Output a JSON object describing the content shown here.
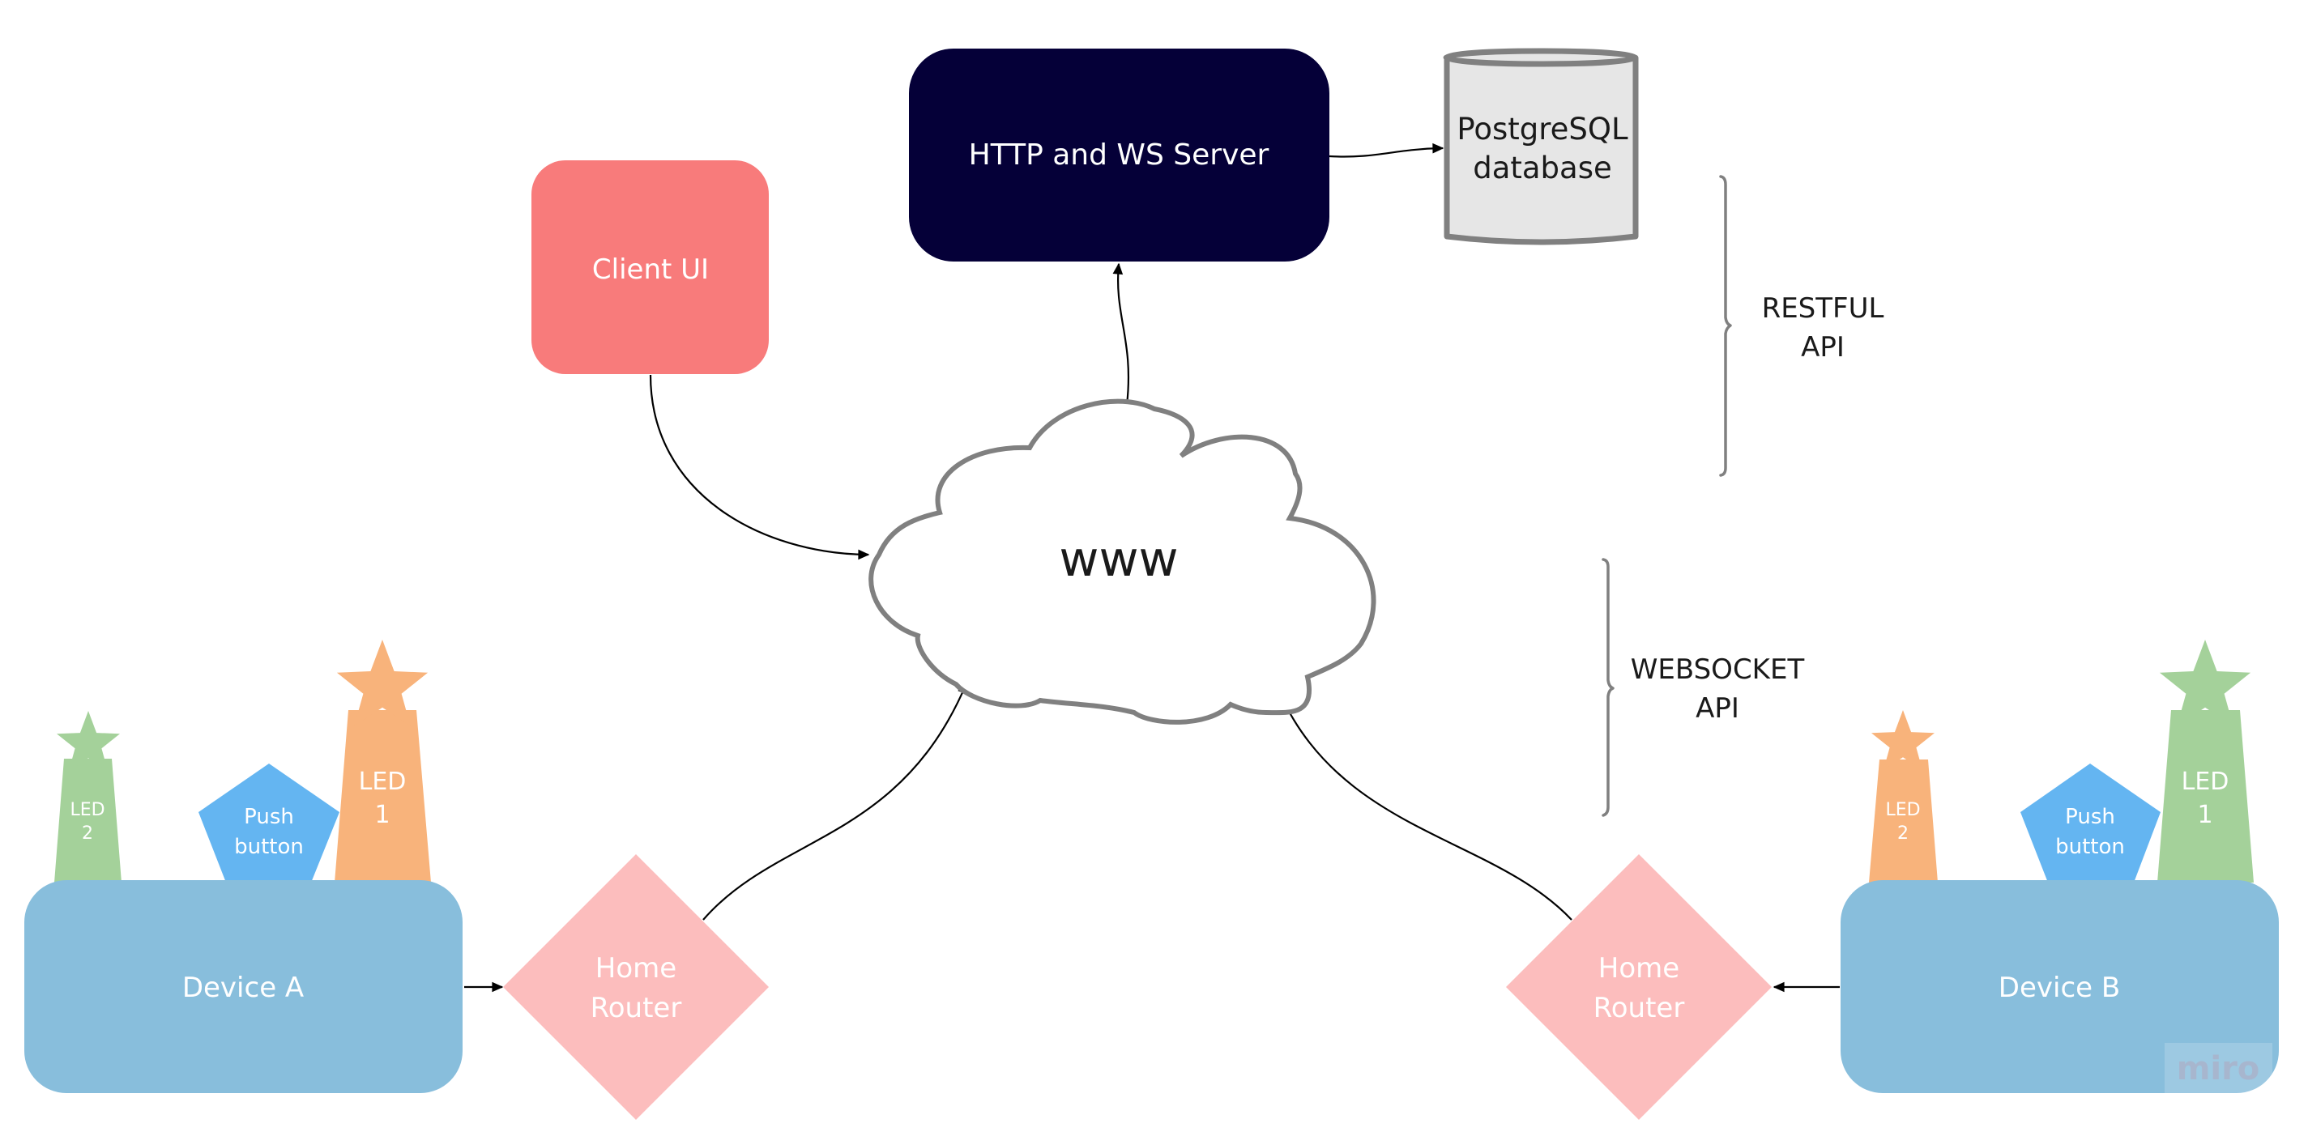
{
  "diagram": {
    "nodes": {
      "server": {
        "label": "HTTP and WS Server",
        "color": "#050038",
        "text_color": "#ffffff"
      },
      "database": {
        "lines": [
          "PostgreSQL",
          "database"
        ],
        "fill": "#E6E6E6",
        "stroke": "#808080",
        "text_color": "#1a1a1a"
      },
      "client_ui": {
        "label": "Client UI",
        "color": "#F87B7B",
        "text_color": "#ffffff"
      },
      "cloud": {
        "label": "www",
        "stroke": "#808080",
        "text_color": "#1a1a1a"
      },
      "device_a": {
        "label": "Device A",
        "color": "#88BEDC",
        "led2": {
          "lines": [
            "LED",
            "2"
          ],
          "color": "#A4D19A"
        },
        "push_button": {
          "lines": [
            "Push",
            "button"
          ],
          "color": "#64B5F1"
        },
        "led1": {
          "lines": [
            "LED",
            "1"
          ],
          "color": "#F8B37B"
        }
      },
      "device_b": {
        "label": "Device B",
        "color": "#88BEDC",
        "led2": {
          "lines": [
            "LED",
            "2"
          ],
          "color": "#F8B37B"
        },
        "push_button": {
          "lines": [
            "Push",
            "button"
          ],
          "color": "#64B5F1"
        },
        "led1": {
          "lines": [
            "LED",
            "1"
          ],
          "color": "#A4D19A"
        }
      },
      "router_a": {
        "lines": [
          "Home",
          "Router"
        ],
        "color": "#FCBDBD"
      },
      "router_b": {
        "lines": [
          "Home",
          "Router"
        ],
        "color": "#FCBDBD"
      }
    },
    "annotations": {
      "restful": {
        "lines": [
          "RESTFUL",
          "API"
        ]
      },
      "websocket": {
        "lines": [
          "WEBSOCKET",
          "API"
        ]
      }
    },
    "edges": [
      {
        "from": "server",
        "to": "database"
      },
      {
        "from": "cloud",
        "to": "server"
      },
      {
        "from": "client_ui",
        "to": "cloud"
      },
      {
        "from": "router_a",
        "to": "cloud"
      },
      {
        "from": "router_b",
        "to": "cloud"
      },
      {
        "from": "device_a",
        "to": "router_a"
      },
      {
        "from": "device_b",
        "to": "router_b"
      }
    ],
    "watermark": "miro"
  }
}
